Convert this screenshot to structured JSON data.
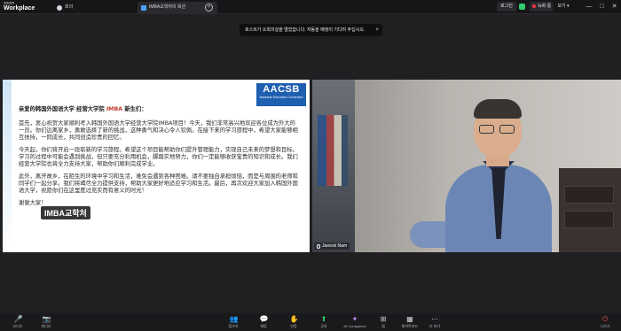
{
  "app": {
    "logo_top": "zoom",
    "logo_bottom": "Workplace"
  },
  "tabs": [
    {
      "label": "회의"
    },
    {
      "label": "IMBA교학처의 회관"
    }
  ],
  "topright": {
    "login": "로그인",
    "recording": "녹화 중",
    "view": "보기",
    "win": [
      "—",
      "□",
      "✕"
    ]
  },
  "banner": {
    "text": "호스트가 소회의실을 열었습니다. 자동을 배정이 기다려 주십시오.",
    "close": "×"
  },
  "slide": {
    "logo": {
      "big": "AACSB",
      "small": "Business Education Connected"
    },
    "greeting_pre": "亲爱的韩国外国语大学 经营大学院 ",
    "greeting_emph": "IMBA",
    "greeting_post": " 新生们：",
    "paragraphs": [
      "首先，衷心祝贺大家顺利考入韩国外国语大学经营大学院IMBA项目！今天，我们非常高兴地欢迎各位成为外大的一员。你们远离家乡，勇敢选择了新的挑战，这种勇气和决心令人钦佩。在接下来的学习旅程中，希望大家能够相互扶持，一同成长，共同创造珍贵的回忆。",
      "今天起，你们将开启一段崭新的学习旅程。希望这个项目能帮助你们提升管理能力，实现自己未来的梦想和目标。学习的过程中可能会遇到挑战，但只要充分利用机会，脚踏实地努力，你们一定能够收获宝贵的知识和成长。我们经营大学院也将全力支持大家，帮助你们顺利完成学业。",
      "此外，离开故乡，在陌生的环境中学习和生活，难免会遇到各种困难。请不要独自承担烦恼，而是与周围的老师和同学们一起分享。我们将竭尽全力提供支持，帮助大家更好地适应学习和生活。最后，再次欢迎大家加入韩国外国语大学，祝愿你们在这里度过充实而有意义的时光！",
      "谢谢大家！"
    ],
    "caption": "IMBA교학처"
  },
  "video": {
    "participant": "Jaeeok Nam"
  },
  "toolbar": [
    {
      "icon": "🎤",
      "label": "오디오"
    },
    {
      "icon": "📷",
      "label": "비디오"
    },
    {
      "icon": "👥",
      "label": "참가자"
    },
    {
      "icon": "💬",
      "label": "채팅"
    },
    {
      "icon": "✋",
      "label": "반응"
    },
    {
      "icon": "⬆",
      "label": "공유"
    },
    {
      "icon": "✦",
      "label": "AI Companion"
    },
    {
      "icon": "⊞",
      "label": "앱"
    },
    {
      "icon": "▦",
      "label": "화이트보드"
    },
    {
      "icon": "⋯",
      "label": "더 보기"
    },
    {
      "icon": "⏻",
      "label": "나가기"
    }
  ]
}
